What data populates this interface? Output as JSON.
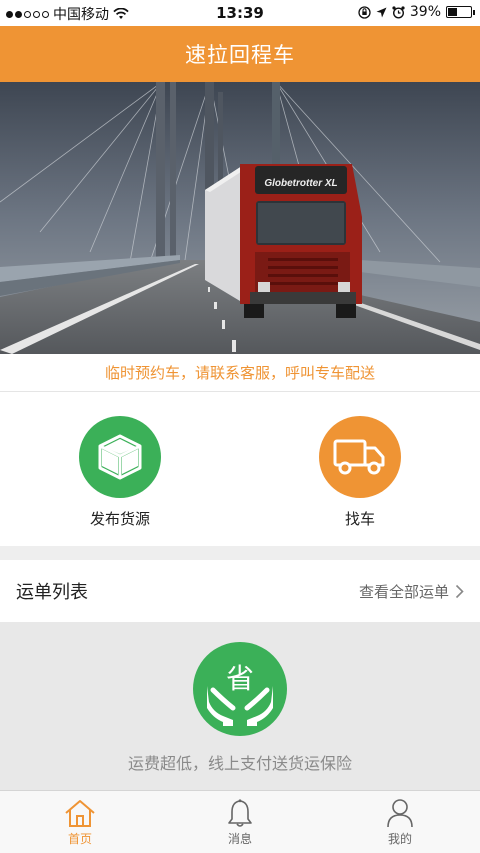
{
  "status_bar": {
    "carrier": "中国移动",
    "time": "13:39",
    "battery": "39%",
    "battery_level": 0.39
  },
  "header": {
    "title": "速拉回程车"
  },
  "banner": {
    "truck_text": "Globetrotter XL"
  },
  "notice": {
    "text": "临时预约车，请联系客服，呼叫专车配送"
  },
  "actions": [
    {
      "label": "发布货源",
      "icon": "cube-icon",
      "color": "#3bb058"
    },
    {
      "label": "找车",
      "icon": "truck-icon",
      "color": "#ef9434"
    }
  ],
  "order_list": {
    "title": "运单列表",
    "view_all": "查看全部运单"
  },
  "promo": {
    "badge": "省",
    "text": "运费超低，线上支付送货运保险"
  },
  "tabs": [
    {
      "label": "首页",
      "icon": "home-icon",
      "active": true
    },
    {
      "label": "消息",
      "icon": "bell-icon",
      "active": false
    },
    {
      "label": "我的",
      "icon": "user-icon",
      "active": false
    }
  ],
  "colors": {
    "accent": "#ef9434",
    "green": "#3bb058"
  }
}
